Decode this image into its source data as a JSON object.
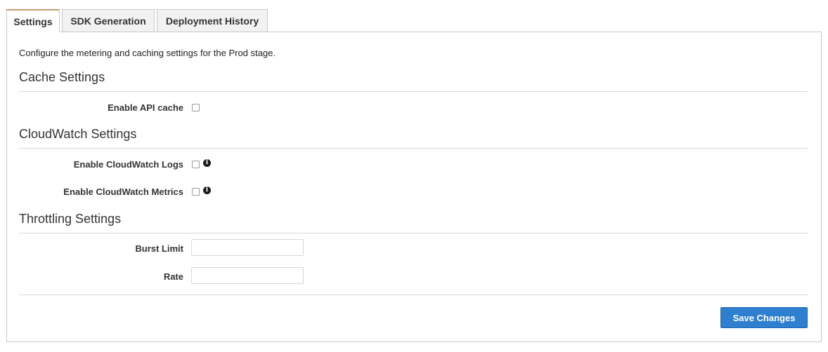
{
  "tabs": [
    {
      "label": "Settings",
      "active": true
    },
    {
      "label": "SDK Generation",
      "active": false
    },
    {
      "label": "Deployment History",
      "active": false
    }
  ],
  "intro": "Configure the metering and caching settings for the Prod stage.",
  "cache": {
    "title": "Cache Settings",
    "enable_api_cache_label": "Enable API cache",
    "enable_api_cache_checked": false
  },
  "cloudwatch": {
    "title": "CloudWatch Settings",
    "logs_label": "Enable CloudWatch Logs",
    "logs_checked": false,
    "metrics_label": "Enable CloudWatch Metrics",
    "metrics_checked": false,
    "info_icon": "info-icon"
  },
  "throttling": {
    "title": "Throttling Settings",
    "burst_limit_label": "Burst Limit",
    "burst_limit_value": "",
    "rate_label": "Rate",
    "rate_value": ""
  },
  "actions": {
    "save_label": "Save Changes"
  },
  "colors": {
    "accent_tab": "#c69a6d",
    "primary_button": "#2e7fd0"
  }
}
